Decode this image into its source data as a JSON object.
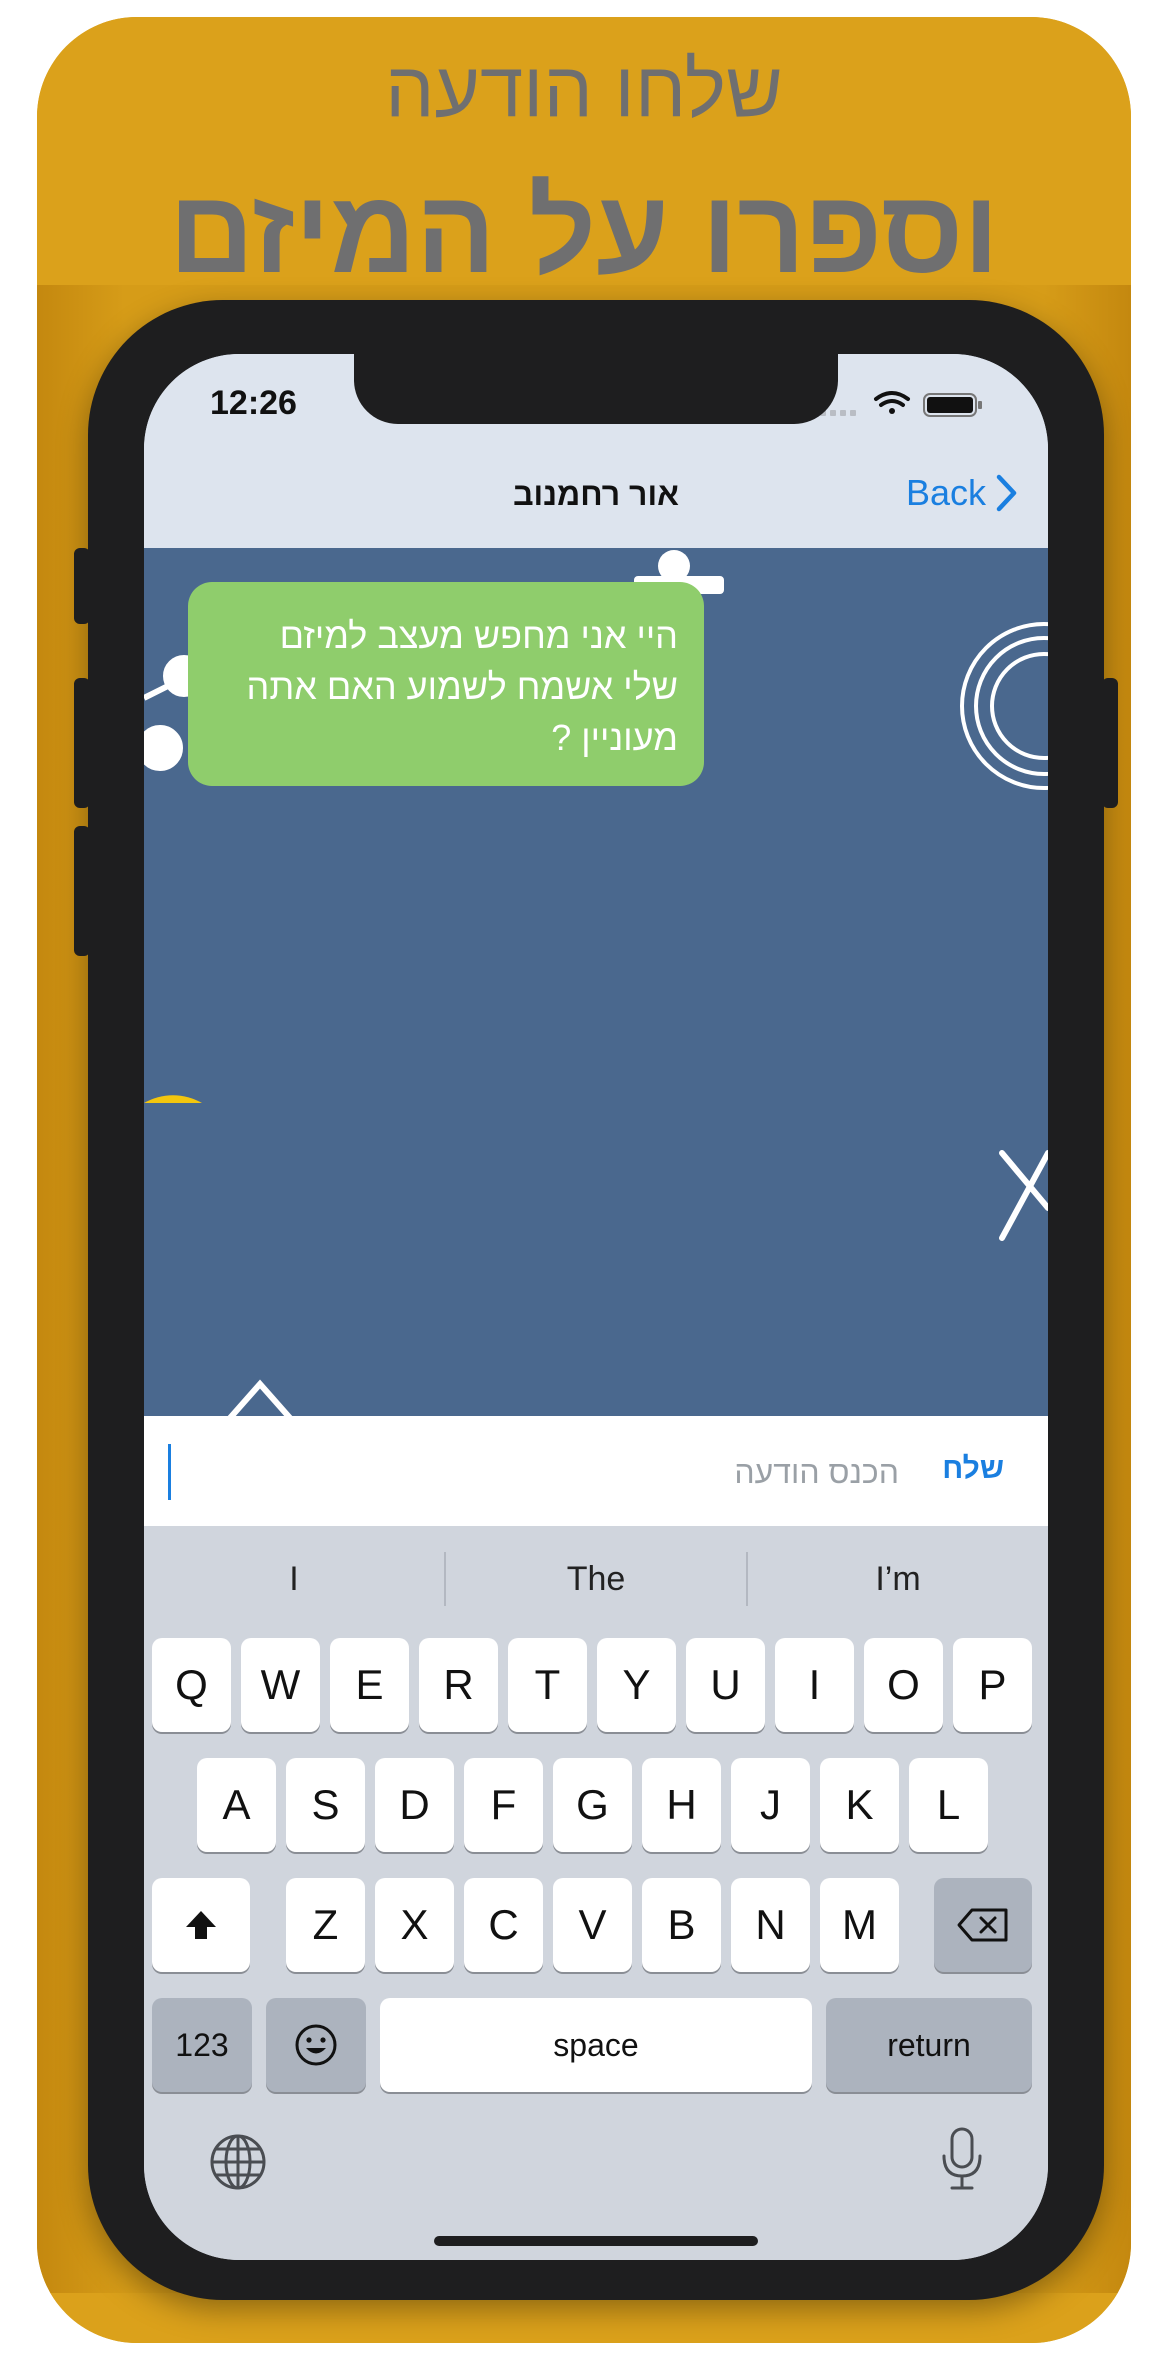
{
  "promo": {
    "line1": "שלחו הודעה",
    "line2": "וספרו על המיזם"
  },
  "status_bar": {
    "time": "12:26",
    "icons": [
      "cellular-signal-icon",
      "wifi-icon",
      "battery-icon"
    ]
  },
  "nav": {
    "title": "אור רחמנוב",
    "back_label": "Back",
    "back_icon": "chevron-right-icon"
  },
  "chat": {
    "background_color": "#4a688e",
    "messages": [
      {
        "text": "היי אני מחפש מעצב למיזם שלי אשמח לשמוע האם אתה מעוניין ?",
        "bubble_color": "#8fcd6c"
      }
    ]
  },
  "composer": {
    "placeholder": "הכנס הודעה",
    "value": "",
    "send_label": "שלח"
  },
  "keyboard": {
    "suggestions": [
      "I",
      "The",
      "I’m"
    ],
    "row1": [
      "Q",
      "W",
      "E",
      "R",
      "T",
      "Y",
      "U",
      "I",
      "O",
      "P"
    ],
    "row2": [
      "A",
      "S",
      "D",
      "F",
      "G",
      "H",
      "J",
      "K",
      "L"
    ],
    "row3": [
      "Z",
      "X",
      "C",
      "V",
      "B",
      "N",
      "M"
    ],
    "numbers_label": "123",
    "space_label": "space",
    "return_label": "return",
    "globe_icon": "globe-icon",
    "mic_icon": "microphone-icon",
    "shift_icon": "shift-icon",
    "delete_icon": "backspace-icon",
    "emoji_icon": "emoji-icon"
  },
  "colors": {
    "frame_gold": "#d79f19",
    "promo_text": "#6f6f70",
    "accent_blue": "#1a7fe0",
    "keyboard_bg": "#d0d5dd"
  }
}
